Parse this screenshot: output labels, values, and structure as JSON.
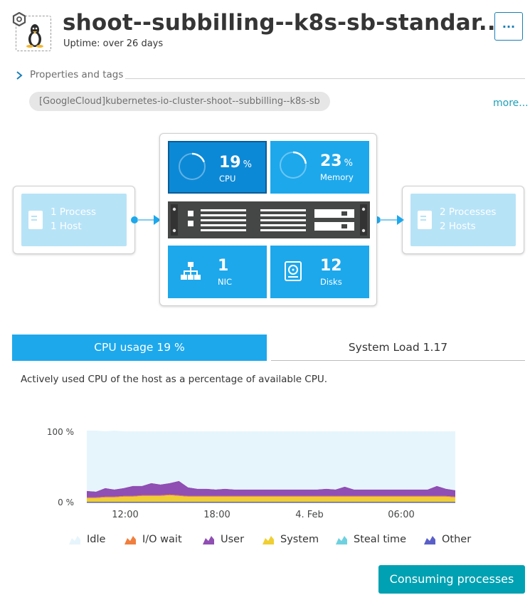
{
  "header": {
    "title": "shoot--subbilling--k8s-sb-standar...",
    "uptime": "Uptime: over 26 days",
    "more_button": "···"
  },
  "properties": {
    "label": "Properties and tags",
    "tag": "[GoogleCloud]kubernetes-io-cluster-shoot--subbilling--k8s-sb",
    "more_link": "more..."
  },
  "infographic": {
    "left": {
      "line1": "1 Process",
      "line2": "1 Host"
    },
    "right": {
      "line1": "2 Processes",
      "line2": "2 Hosts"
    },
    "cpu": {
      "value": "19",
      "unit": "%",
      "label": "CPU",
      "percent": 19
    },
    "memory": {
      "value": "23",
      "unit": "%",
      "label": "Memory",
      "percent": 23
    },
    "nic": {
      "value": "1",
      "label": "NIC"
    },
    "disks": {
      "value": "12",
      "label": "Disks"
    }
  },
  "tabs": [
    {
      "label": "CPU usage 19 %",
      "active": true
    },
    {
      "label": "System Load 1.17",
      "active": false
    }
  ],
  "description": "Actively used CPU of the host as a percentage of available CPU.",
  "chart_data": {
    "type": "area",
    "ylabels": [
      "100 %",
      "0 %"
    ],
    "ylim": [
      0,
      100
    ],
    "xlabels": [
      "12:00",
      "18:00",
      "4. Feb",
      "06:00"
    ],
    "x": [
      0,
      1,
      2,
      3,
      4,
      5,
      6,
      7,
      8,
      9,
      10,
      11,
      12,
      13,
      14,
      15,
      16,
      17,
      18,
      19,
      20,
      21,
      22,
      23,
      24,
      25,
      26,
      27,
      28,
      29,
      30,
      31,
      32,
      33,
      34,
      35,
      36,
      37,
      38,
      39,
      40
    ],
    "series": [
      {
        "name": "Other",
        "color": "#5a5fc8",
        "values": [
          1,
          1,
          1,
          1,
          1,
          1,
          1,
          1,
          1,
          1,
          1,
          1,
          1,
          1,
          1,
          1,
          1,
          1,
          1,
          1,
          1,
          1,
          1,
          1,
          1,
          1,
          1,
          1,
          1,
          1,
          1,
          1,
          1,
          1,
          1,
          1,
          1,
          1,
          1,
          1,
          1
        ]
      },
      {
        "name": "Steal time",
        "color": "#6fd1e0",
        "values": [
          0,
          0,
          0,
          0,
          0,
          0,
          0,
          0,
          0,
          0,
          0,
          0,
          0,
          0,
          0,
          0,
          0,
          0,
          0,
          0,
          0,
          0,
          0,
          0,
          0,
          0,
          0,
          0,
          0,
          0,
          0,
          0,
          0,
          0,
          0,
          0,
          0,
          0,
          0,
          0,
          0
        ]
      },
      {
        "name": "System",
        "color": "#efcf33",
        "values": [
          5,
          5,
          6,
          6,
          7,
          7,
          8,
          8,
          8,
          9,
          8,
          7,
          7,
          7,
          7,
          7,
          7,
          7,
          7,
          7,
          7,
          7,
          7,
          7,
          7,
          7,
          7,
          7,
          7,
          7,
          7,
          7,
          7,
          7,
          7,
          7,
          7,
          7,
          7,
          7,
          6
        ]
      },
      {
        "name": "I/O wait",
        "color": "#f07e3e",
        "values": [
          1,
          1,
          1,
          1,
          1,
          1,
          1,
          1,
          1,
          1,
          1,
          1,
          1,
          1,
          1,
          1,
          1,
          1,
          1,
          1,
          1,
          1,
          1,
          1,
          1,
          1,
          1,
          1,
          1,
          1,
          1,
          1,
          1,
          1,
          1,
          1,
          1,
          1,
          1,
          1,
          1
        ]
      },
      {
        "name": "User",
        "color": "#8f4fb3",
        "values": [
          9,
          8,
          12,
          10,
          11,
          14,
          13,
          17,
          15,
          16,
          20,
          12,
          10,
          10,
          9,
          10,
          9,
          9,
          9,
          9,
          9,
          9,
          9,
          9,
          9,
          9,
          10,
          9,
          13,
          9,
          9,
          9,
          9,
          9,
          9,
          9,
          9,
          9,
          14,
          10,
          9
        ]
      },
      {
        "name": "Idle",
        "color": "#e6f5fc",
        "values": [
          84,
          85,
          79,
          82,
          79,
          76,
          76,
          72,
          74,
          72,
          69,
          78,
          80,
          80,
          81,
          80,
          81,
          81,
          81,
          81,
          81,
          81,
          81,
          81,
          81,
          81,
          80,
          81,
          77,
          81,
          81,
          81,
          81,
          81,
          81,
          81,
          81,
          81,
          76,
          80,
          82
        ]
      }
    ],
    "legend": [
      "Idle",
      "I/O wait",
      "User",
      "System",
      "Steal time",
      "Other"
    ]
  },
  "legend_colors": {
    "Idle": "#e6f5fc",
    "I/O wait": "#f07e3e",
    "User": "#8f4fb3",
    "System": "#efcf33",
    "Steal time": "#6fd1e0",
    "Other": "#5a5fc8"
  },
  "button": {
    "consuming": "Consuming processes"
  }
}
